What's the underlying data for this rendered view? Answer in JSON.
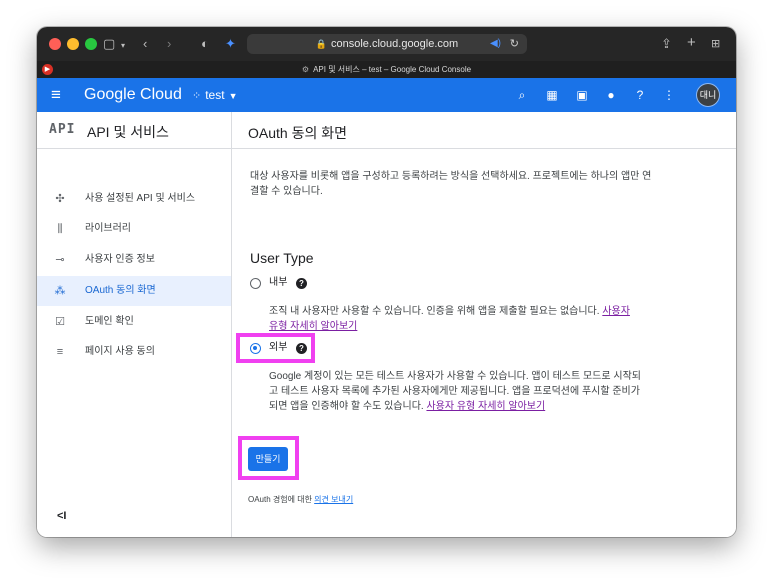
{
  "browser": {
    "url": "console.cloud.google.com",
    "tab_title": "API 및 서비스 – test – Google Cloud Console"
  },
  "header": {
    "logo": "Google Cloud",
    "project": "test",
    "avatar": "대니"
  },
  "sidebar": {
    "title_badge": "API",
    "title": "API 및 서비스",
    "items": [
      {
        "label": "사용 설정된 API 및 서비스",
        "icon": "enabled-apis-icon"
      },
      {
        "label": "라이브러리",
        "icon": "library-icon"
      },
      {
        "label": "사용자 인증 정보",
        "icon": "key-icon"
      },
      {
        "label": "OAuth 동의 화면",
        "icon": "oauth-consent-icon"
      },
      {
        "label": "도메인 확인",
        "icon": "domain-check-icon"
      },
      {
        "label": "페이지 사용 동의",
        "icon": "page-usage-icon"
      }
    ],
    "collapse": "<I"
  },
  "main": {
    "title": "OAuth 동의 화면",
    "description": "대상 사용자를 비롯해 앱을 구성하고 등록하려는 방식을 선택하세요. 프로젝트에는 하나의 앱만 연결할 수 있습니다.",
    "user_type_heading": "User Type",
    "internal": {
      "label": "내부",
      "description": "조직 내 사용자만 사용할 수 있습니다. 인증을 위해 앱을 제출할 필요는 없습니다.",
      "link": "사용자 유형 자세히 알아보기"
    },
    "external": {
      "label": "외부",
      "description": "Google 계정이 있는 모든 테스트 사용자가 사용할 수 있습니다. 앱이 테스트 모드로 시작되고 테스트 사용자 목록에 추가된 사용자에게만 제공됩니다. 앱을 프로덕션에 푸시할 준비가 되면 앱을 인증해야 할 수도 있습니다.",
      "link": "사용자 유형 자세히 알아보기"
    },
    "selected_user_type": "외부",
    "create_button": "만들기",
    "feedback_prefix": "OAuth 경험에 대한",
    "feedback_link": "의견 보내기"
  },
  "colors": {
    "header_blue": "#1a73e8",
    "highlight": "#f040f0",
    "active_nav_bg": "#e8f0fe"
  }
}
